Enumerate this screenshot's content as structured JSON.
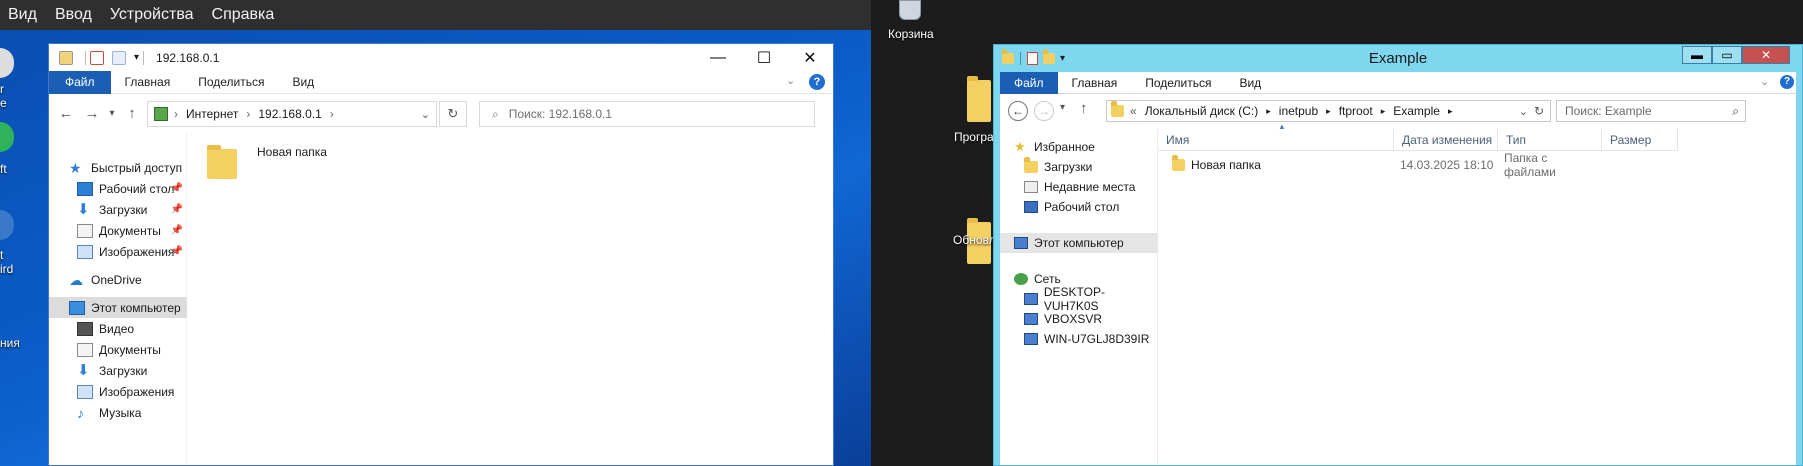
{
  "vm_menu": [
    "Вид",
    "Ввод",
    "Устройства",
    "Справка"
  ],
  "win10_desktop": {
    "fragments": [
      "r",
      "e",
      "ft",
      "t",
      "ird",
      "ния"
    ]
  },
  "win10_explorer": {
    "title": "192.168.0.1",
    "ribbon_tabs": [
      "Файл",
      "Главная",
      "Поделиться",
      "Вид"
    ],
    "help": "?",
    "address": {
      "segments": [
        "Интернет",
        "192.168.0.1"
      ]
    },
    "search_placeholder": "Поиск: 192.168.0.1",
    "sidebar": [
      {
        "label": "Быстрый доступ",
        "icon": "star-icon",
        "pinned": false
      },
      {
        "label": "Рабочий стол",
        "icon": "desktop-icon",
        "pinned": true
      },
      {
        "label": "Загрузки",
        "icon": "download-arrow-icon",
        "pinned": true
      },
      {
        "label": "Документы",
        "icon": "documents-icon",
        "pinned": true
      },
      {
        "label": "Изображения",
        "icon": "pictures-icon",
        "pinned": true
      },
      {
        "label": "OneDrive",
        "icon": "cloud-icon",
        "pinned": false
      },
      {
        "label": "Этот компьютер",
        "icon": "computer-icon",
        "pinned": false,
        "selected": true
      },
      {
        "label": "Видео",
        "icon": "video-icon",
        "pinned": false
      },
      {
        "label": "Документы",
        "icon": "documents-icon",
        "pinned": false
      },
      {
        "label": "Загрузки",
        "icon": "download-arrow-icon",
        "pinned": false
      },
      {
        "label": "Изображения",
        "icon": "pictures-icon",
        "pinned": false
      },
      {
        "label": "Музыка",
        "icon": "music-icon",
        "pinned": false
      }
    ],
    "content": [
      {
        "name": "Новая папка",
        "icon": "folder-icon"
      }
    ]
  },
  "server_desktop": {
    "icons": [
      {
        "label": "Корзина",
        "icon": "recycle-bin-icon"
      },
      {
        "label": "Програ",
        "icon": "folder-icon"
      },
      {
        "label": "Обновл",
        "icon": "folder-icon"
      }
    ]
  },
  "server_explorer": {
    "title": "Example",
    "ribbon_tabs": [
      "Файл",
      "Главная",
      "Поделиться",
      "Вид"
    ],
    "address": {
      "prefix": "«",
      "segments": [
        "Локальный диск (C:)",
        "inetpub",
        "ftproot",
        "Example"
      ]
    },
    "search_placeholder": "Поиск: Example",
    "sidebar": [
      {
        "label": "Избранное",
        "icon": "star-icon",
        "indent": 0
      },
      {
        "label": "Загрузки",
        "icon": "downloads-icon",
        "indent": 1
      },
      {
        "label": "Недавние места",
        "icon": "recent-places-icon",
        "indent": 1
      },
      {
        "label": "Рабочий стол",
        "icon": "desktop-icon",
        "indent": 1
      },
      {
        "label": "Этот компьютер",
        "icon": "computer-icon",
        "indent": 0,
        "selected": true
      },
      {
        "label": "Сеть",
        "icon": "network-icon",
        "indent": 0
      },
      {
        "label": "DESKTOP-VUH7K0S",
        "icon": "computer-icon",
        "indent": 1
      },
      {
        "label": "VBOXSVR",
        "icon": "computer-icon",
        "indent": 1
      },
      {
        "label": "WIN-U7GLJ8D39IR",
        "icon": "computer-icon",
        "indent": 1
      }
    ],
    "columns": [
      "Имя",
      "Дата изменения",
      "Тип",
      "Размер"
    ],
    "rows": [
      {
        "name": "Новая папка",
        "modified": "14.03.2025 18:10",
        "type": "Папка с файлами",
        "size": ""
      }
    ]
  },
  "colors": {
    "ribbon_file_tab": "#1a5fb4",
    "server_frame": "#7fd6ef",
    "win10_wallpaper": "#0b5cc7",
    "folder": "#f4cf62"
  }
}
